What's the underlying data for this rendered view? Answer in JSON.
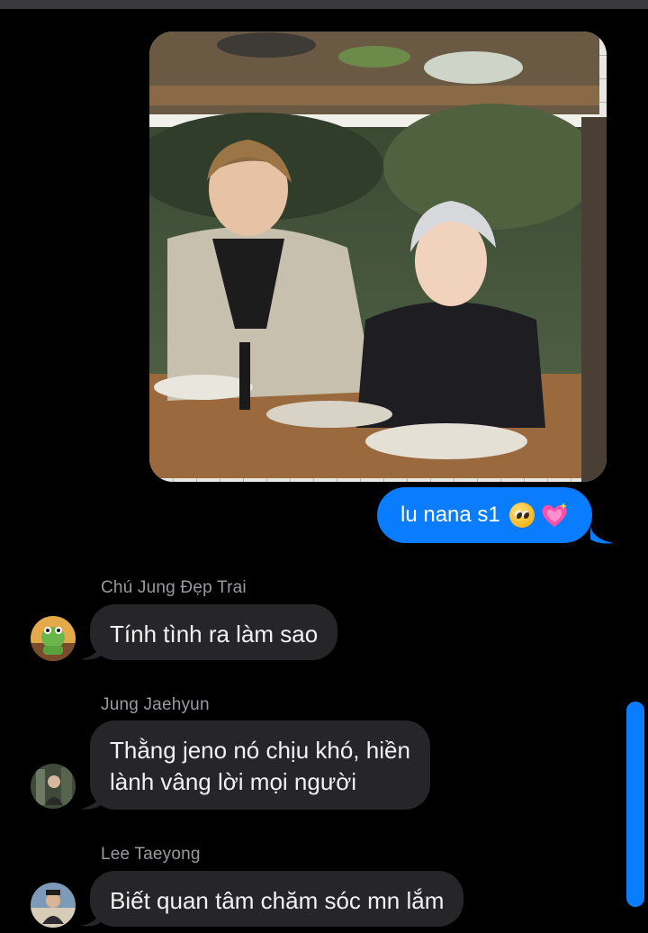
{
  "photo": {
    "icon": "shared-photo"
  },
  "sent_message": {
    "text": "lu nana s1",
    "emojis": [
      "pleading-face-icon",
      "sparkling-heart-icon"
    ]
  },
  "messages": [
    {
      "sender": "Chú Jung Đẹp Trai",
      "text": "Tính tình ra làm sao",
      "avatar": "frog-avatar"
    },
    {
      "sender": "Jung Jaehyun",
      "lines": [
        "Thằng jeno nó chịu khó, hiền",
        "lành vâng lời mọi người"
      ],
      "avatar": "photo-avatar"
    },
    {
      "sender": "Lee Taeyong",
      "text": "Biết quan tâm chăm sóc mn lắm",
      "avatar": "photo-avatar"
    }
  ],
  "colors": {
    "sent_bubble": "#0a7cff",
    "received_bubble": "#262628",
    "background": "#000000",
    "sender_name": "#9a9aa0"
  }
}
